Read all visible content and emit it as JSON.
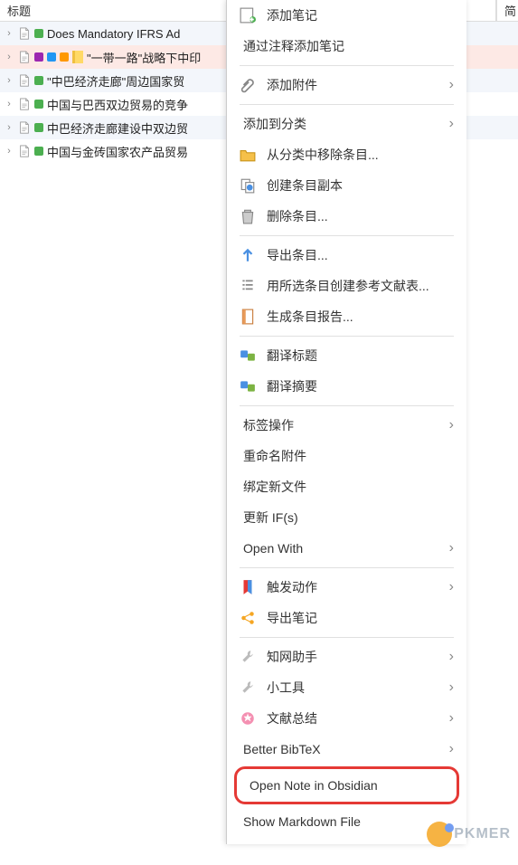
{
  "header": {
    "title_col": "标题",
    "right_col": "简"
  },
  "list": {
    "items": [
      {
        "title": "Does Mandatory IFRS Ad",
        "tags": [
          "green"
        ],
        "selected": false,
        "even": true
      },
      {
        "title": "\"一带一路\"战略下中印",
        "tags": [
          "purple",
          "blue",
          "orange"
        ],
        "has_note": true,
        "selected": true,
        "even": false
      },
      {
        "title": "\"中巴经济走廊\"周边国家贸",
        "tags": [
          "green"
        ],
        "selected": false,
        "even": true
      },
      {
        "title": "中国与巴西双边贸易的竞争",
        "tags": [
          "green"
        ],
        "selected": false,
        "even": false
      },
      {
        "title": "中巴经济走廊建设中双边贸",
        "tags": [
          "green"
        ],
        "selected": false,
        "even": true
      },
      {
        "title": "中国与金砖国家农产品贸易",
        "tags": [
          "green"
        ],
        "selected": false,
        "even": false
      }
    ]
  },
  "menu": {
    "add_note": "添加笔记",
    "add_note_annotation": "通过注释添加笔记",
    "add_attachment": "添加附件",
    "add_to_category": "添加到分类",
    "remove_from_category": "从分类中移除条目...",
    "duplicate": "创建条目副本",
    "delete_item": "删除条目...",
    "export_item": "导出条目...",
    "create_bib": "用所选条目创建参考文献表...",
    "report": "生成条目报告...",
    "translate_title": "翻译标题",
    "translate_abstract": "翻译摘要",
    "tag_ops": "标签操作",
    "rename_attachment": "重命名附件",
    "bind_new_file": "绑定新文件",
    "update_ifs": "更新 IF(s)",
    "open_with": "Open With",
    "trigger_action": "触发动作",
    "export_note": "导出笔记",
    "cnki_helper": "知网助手",
    "tools": "小工具",
    "summary": "文献总结",
    "better_bibtex": "Better BibTeX",
    "open_obsidian": "Open Note in Obsidian",
    "show_md": "Show Markdown File"
  },
  "watermark": "PKMER"
}
